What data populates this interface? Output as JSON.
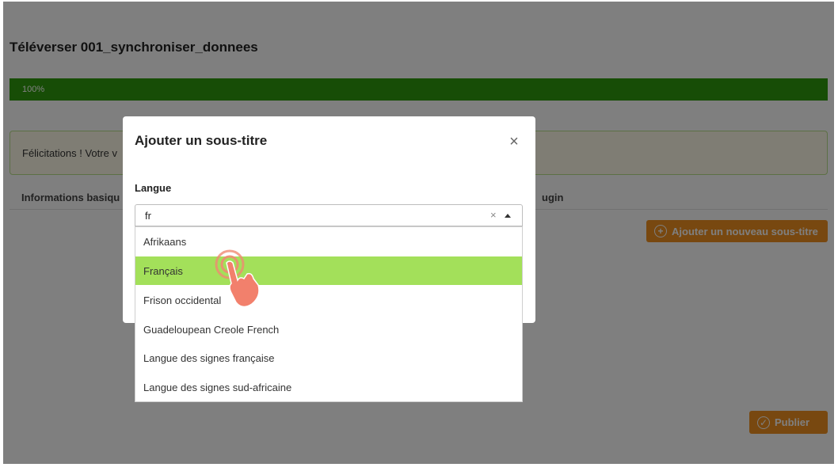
{
  "page": {
    "title": "Téléverser 001_synchroniser_donnees",
    "progress": {
      "label": "100%",
      "value": 100
    },
    "alert_text": "Félicitations ! Votre v",
    "tabs": [
      "Informations basiqu",
      "ugin"
    ],
    "add_subtitle_button": "Ajouter un nouveau sous-titre",
    "publish_button": "Publier"
  },
  "modal": {
    "title": "Ajouter un sous-titre",
    "close_label": "×",
    "field_label": "Langue",
    "search_value": "fr",
    "clear_label": "×",
    "options": [
      {
        "label": "Afrikaans",
        "selected": false
      },
      {
        "label": "Français",
        "selected": true
      },
      {
        "label": "Frison occidental",
        "selected": false
      },
      {
        "label": "Guadeloupean Creole French",
        "selected": false
      },
      {
        "label": "Langue des signes française",
        "selected": false
      },
      {
        "label": "Langue des signes sud-africaine",
        "selected": false
      }
    ]
  },
  "colors": {
    "progress": "#2e9a0c",
    "accent_orange": "#f09020",
    "highlight_green": "#a3e05a",
    "overlay": "rgba(0,0,0,0.5)"
  }
}
